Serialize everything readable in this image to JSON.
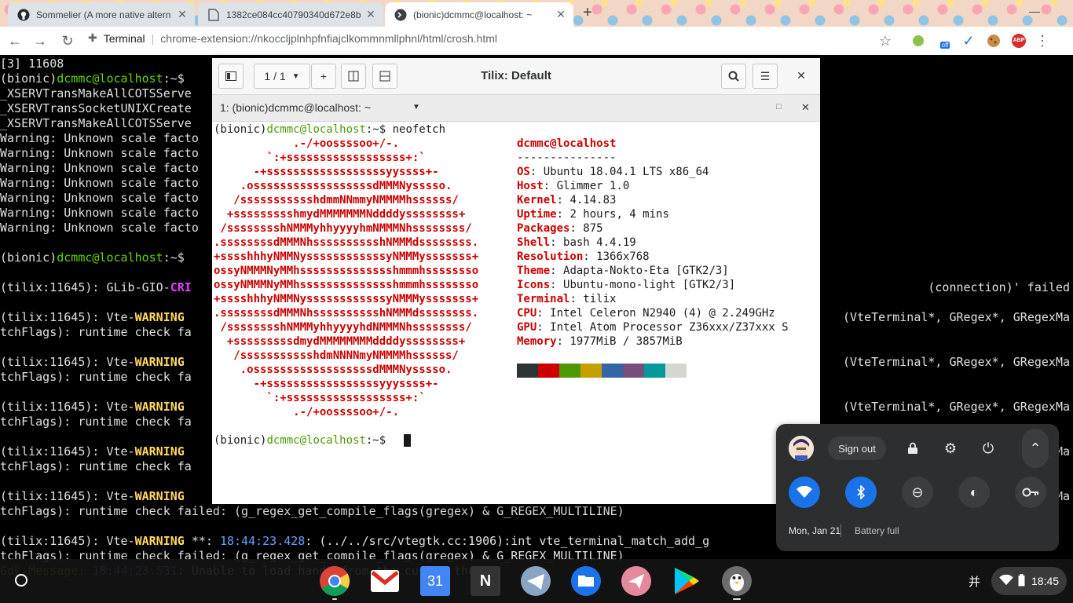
{
  "browser": {
    "tabs": [
      {
        "title": "Sommelier (A more native altern",
        "icon": "github-icon"
      },
      {
        "title": "1382ce084cc40790340d672e8b",
        "icon": "document-icon"
      },
      {
        "title": "(bionic)dcmmc@localhost: ~",
        "icon": "terminal-icon"
      }
    ],
    "new_tab_label": "+",
    "tab_close": "✕",
    "page_label": "Terminal",
    "url": "chrome-extension://nkoccljplnhpfnfiajclkommnmllphnl/html/crosh.html",
    "ext_off_badge": "off",
    "abp_label": "ABP"
  },
  "background_terminal": {
    "lines": [
      {
        "segments": [
          {
            "t": "[3] 11608"
          }
        ]
      },
      {
        "segments": [
          {
            "t": "(bionic)"
          },
          {
            "t": "dcmmc@localhost",
            "c": "g"
          },
          {
            "t": ":~$ "
          }
        ]
      },
      {
        "segments": [
          {
            "t": "_XSERVTransMakeAllCOTSServe"
          }
        ]
      },
      {
        "segments": [
          {
            "t": "_XSERVTransSocketUNIXCreate"
          }
        ]
      },
      {
        "segments": [
          {
            "t": "_XSERVTransMakeAllCOTSServe"
          }
        ]
      },
      {
        "segments": [
          {
            "t": "Warning: Unknown scale facto"
          }
        ]
      },
      {
        "segments": [
          {
            "t": "Warning: Unknown scale facto"
          }
        ]
      },
      {
        "segments": [
          {
            "t": "Warning: Unknown scale facto"
          }
        ]
      },
      {
        "segments": [
          {
            "t": "Warning: Unknown scale facto"
          }
        ]
      },
      {
        "segments": [
          {
            "t": "Warning: Unknown scale facto"
          }
        ]
      },
      {
        "segments": [
          {
            "t": "Warning: Unknown scale facto"
          }
        ]
      },
      {
        "segments": [
          {
            "t": "Warning: Unknown scale facto"
          }
        ]
      },
      {
        "segments": [
          {
            "t": ""
          }
        ]
      },
      {
        "segments": [
          {
            "t": "(bionic)"
          },
          {
            "t": "dcmmc@localhost",
            "c": "g"
          },
          {
            "t": ":~$ "
          }
        ]
      },
      {
        "segments": [
          {
            "t": ""
          }
        ]
      },
      {
        "segments": [
          {
            "t": "(tilix:11645): GLib-GIO-"
          },
          {
            "t": "CRI",
            "c": "m"
          }
        ]
      },
      {
        "segments": [
          {
            "t": ""
          }
        ]
      },
      {
        "segments": [
          {
            "t": "(tilix:11645): Vte-"
          },
          {
            "t": "WARNING",
            "c": "w"
          }
        ]
      },
      {
        "segments": [
          {
            "t": "tchFlags): runtime check fa"
          }
        ]
      },
      {
        "segments": [
          {
            "t": ""
          }
        ]
      },
      {
        "segments": [
          {
            "t": "(tilix:11645): Vte-"
          },
          {
            "t": "WARNING",
            "c": "w"
          }
        ]
      },
      {
        "segments": [
          {
            "t": "tchFlags): runtime check fa"
          }
        ]
      },
      {
        "segments": [
          {
            "t": ""
          }
        ]
      },
      {
        "segments": [
          {
            "t": "(tilix:11645): Vte-"
          },
          {
            "t": "WARNING",
            "c": "w"
          }
        ]
      },
      {
        "segments": [
          {
            "t": "tchFlags): runtime check fa"
          }
        ]
      },
      {
        "segments": [
          {
            "t": ""
          }
        ]
      },
      {
        "segments": [
          {
            "t": "(tilix:11645): Vte-"
          },
          {
            "t": "WARNING",
            "c": "w"
          }
        ]
      },
      {
        "segments": [
          {
            "t": "tchFlags): runtime check fa"
          }
        ]
      },
      {
        "segments": [
          {
            "t": ""
          }
        ]
      },
      {
        "segments": [
          {
            "t": "(tilix:11645): Vte-"
          },
          {
            "t": "WARNING",
            "c": "w"
          }
        ]
      },
      {
        "segments": [
          {
            "t": "tchFlags): runtime check failed: (g_regex_get_compile_flags(gregex) & G_REGEX_MULTILINE)"
          }
        ]
      },
      {
        "segments": [
          {
            "t": ""
          }
        ]
      },
      {
        "segments": [
          {
            "t": "(tilix:11645): Vte-"
          },
          {
            "t": "WARNING",
            "c": "w"
          },
          {
            "t": " **: "
          },
          {
            "t": "18:44:23.428",
            "c": "t"
          },
          {
            "t": ": (../../src/vtegtk.cc:1906):int vte_terminal_match_add_g"
          }
        ]
      },
      {
        "segments": [
          {
            "t": "tchFlags): runtime check failed: (g_regex_get_compile_flags(gregex) & G_REGEX_MULTILINE)"
          }
        ]
      },
      {
        "segments": [
          {
            "t": "Gdk-Message: ",
            "c": "g"
          },
          {
            "t": "18:44:23.531",
            "c": "t"
          },
          {
            "t": ": Unable to load "
          },
          {
            "t": "hand2 from the cursor theme"
          }
        ]
      }
    ],
    "right_fragments": [
      {
        "text": "(connection)' failed",
        "line": 15
      },
      {
        "text": "(VteTerminal*, GRegex*, GRegexMa",
        "line": 17
      },
      {
        "text": "(VteTerminal*, GRegex*, GRegexMa",
        "line": 20
      },
      {
        "text": "(VteTerminal*, GRegex*, GRegexMa",
        "line": 23
      },
      {
        "text": "Ma",
        "line": 26
      },
      {
        "text": "Ma",
        "line": 29
      }
    ]
  },
  "tilix": {
    "title": "Tilix: Default",
    "session_counter": "1 / 1",
    "add_label": "+",
    "close_label": "✕",
    "terminal_title": "1: (bionic)dcmmc@localhost: ~",
    "prompt_prefix": "(bionic)",
    "prompt_host": "dcmmc@localhost",
    "prompt_suffix": ":~$ ",
    "command": "neofetch",
    "logo": [
      "            .-/+oossssoo+/-.",
      "        `:+ssssssssssssssssss+:`",
      "      -+ssssssssssssssssssyyssss+-",
      "    .ossssssssssssssssssdMMMNysssso.",
      "   /ssssssssssshdmmNNmmyNMMMMhssssss/",
      "  +ssssssssshmydMMMMMMMNddddyssssssss+",
      " /sssssssshNMMMyhhyyyyhmNMMMNhssssssss/",
      ".ssssssssdMMMNhsssssssssshNMMMdssssssss.",
      "+sssshhhyNMMNyssssssssssssyNMMMysssssss+",
      "ossyNMMMNyMMhsssssssssssssshmmmhssssssso",
      "ossyNMMMNyMMhsssssssssssssshmmmhssssssso",
      "+sssshhhyNMMNyssssssssssssyNMMMysssssss+",
      ".ssssssssdMMMNhsssssssssshNMMMdssssssss.",
      " /sssssssshNMMMyhhyyyyhdNMMMNhssssssss/",
      "  +sssssssssdmydMMMMMMMMddddyssssssss+",
      "   /ssssssssssshdmNNNNmyNMMMMhssssss/",
      "    .ossssssssssssssssssdMMMNysssso.",
      "      -+sssssssssssssssssyyyssss+-",
      "        `:+ssssssssssssssssss+:`",
      "            .-/+oossssoo+/-."
    ],
    "user_host": "dcmmc@localhost",
    "divider": "---------------",
    "info": [
      {
        "k": "OS",
        "v": "Ubuntu 18.04.1 LTS x86_64"
      },
      {
        "k": "Host",
        "v": "Glimmer 1.0"
      },
      {
        "k": "Kernel",
        "v": "4.14.83"
      },
      {
        "k": "Uptime",
        "v": "2 hours, 4 mins"
      },
      {
        "k": "Packages",
        "v": "875"
      },
      {
        "k": "Shell",
        "v": "bash 4.4.19"
      },
      {
        "k": "Resolution",
        "v": "1366x768"
      },
      {
        "k": "Theme",
        "v": "Adapta-Nokto-Eta [GTK2/3]"
      },
      {
        "k": "Icons",
        "v": "Ubuntu-mono-light [GTK2/3]"
      },
      {
        "k": "Terminal",
        "v": "tilix"
      },
      {
        "k": "CPU",
        "v": "Intel Celeron N2940 (4) @ 2.249GHz"
      },
      {
        "k": "GPU",
        "v": "Intel Atom Processor Z36xxx/Z37xxx S"
      },
      {
        "k": "Memory",
        "v": "1977MiB / 3857MiB"
      }
    ],
    "palette": [
      "#2e3436",
      "#cc0000",
      "#4e9a06",
      "#c4a000",
      "#3465a4",
      "#75507b",
      "#06989a",
      "#d3d7cf"
    ]
  },
  "quick_settings": {
    "sign_out_label": "Sign out",
    "date": "Mon, Jan 21",
    "battery": "Battery full"
  },
  "shelf": {
    "apps": [
      "chrome-icon",
      "gmail-icon",
      "calendar-icon",
      "notion-icon",
      "telegram-icon",
      "files-icon",
      "paper-plane-icon",
      "play-store-icon",
      "tux-icon"
    ],
    "calendar_day": "31",
    "notion_letter": "N",
    "ime": "并",
    "time": "18:45"
  }
}
